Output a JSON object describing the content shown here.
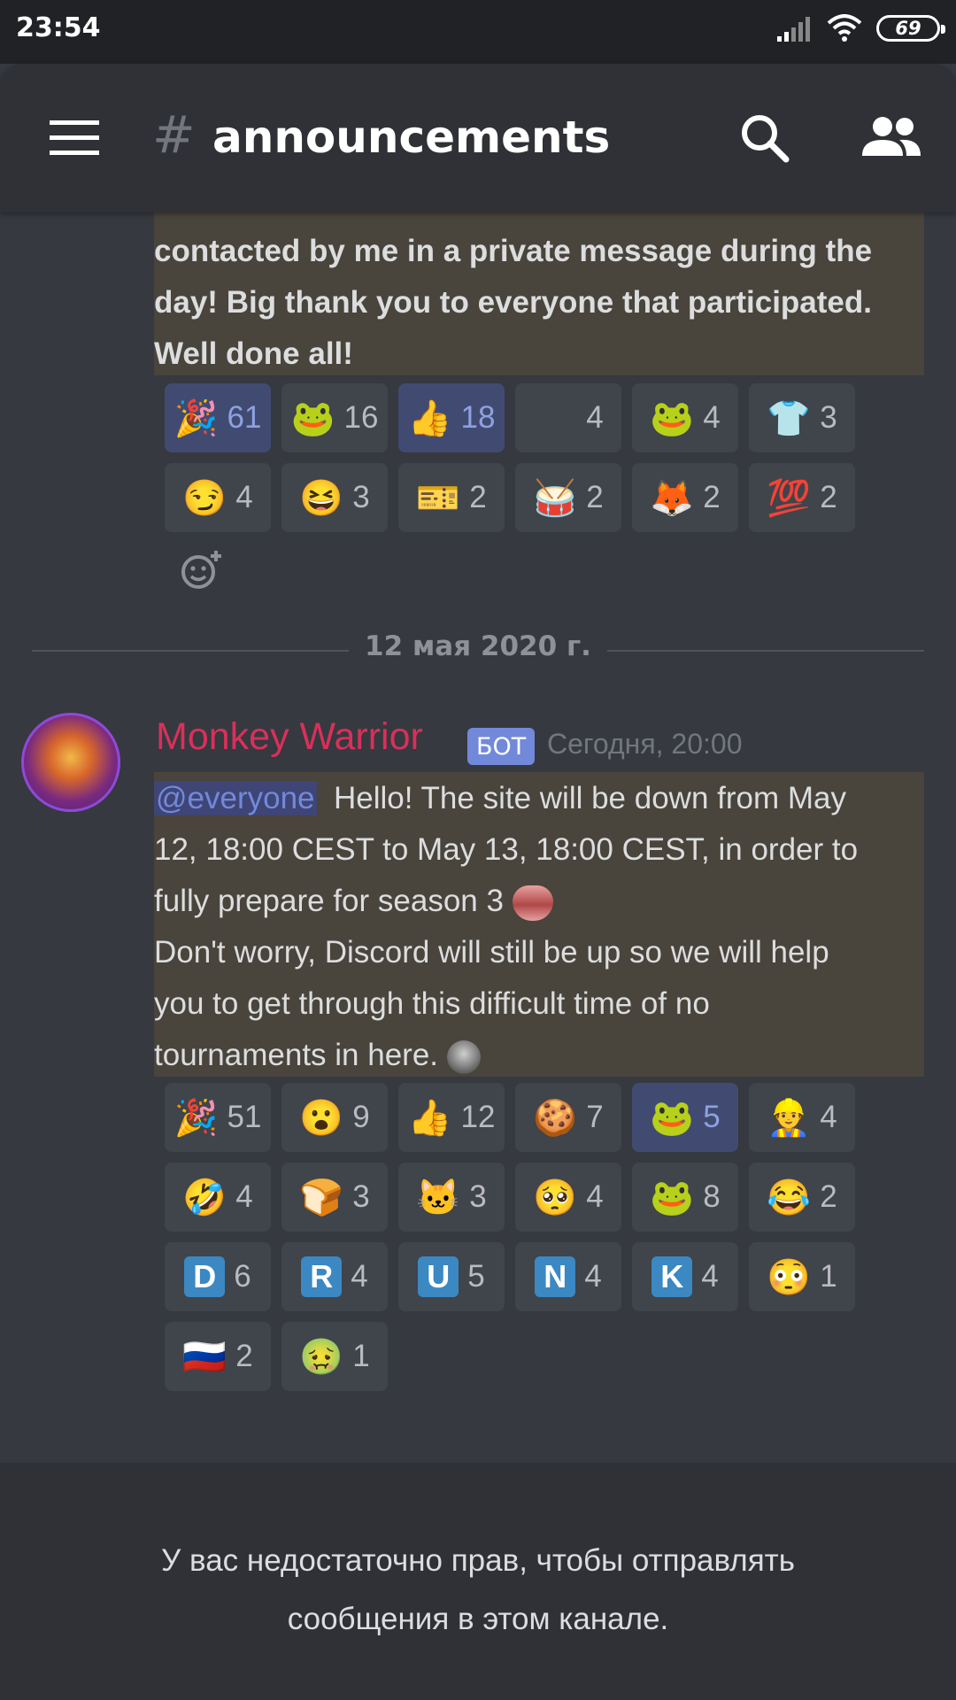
{
  "status_bar": {
    "time": "23:54",
    "battery": "69"
  },
  "header": {
    "hash": "#",
    "channel_name": "announcements"
  },
  "message1": {
    "lines": [
      "contacted by me in a private message during the",
      "day! Big thank you to everyone that participated.",
      "Well done all!"
    ],
    "reactions": [
      {
        "emoji": "party-popper",
        "glyph": "🎉",
        "count": "61",
        "me": true
      },
      {
        "emoji": "pepe-hug",
        "glyph": "🐸",
        "count": "16",
        "me": false
      },
      {
        "emoji": "thumbs-up",
        "glyph": "👍",
        "count": "18",
        "me": true
      },
      {
        "emoji": "blank",
        "glyph": "",
        "count": "4",
        "me": false
      },
      {
        "emoji": "pepe-yes",
        "glyph": "🐸",
        "count": "4",
        "me": false
      },
      {
        "emoji": "t-shirt",
        "glyph": "👕",
        "count": "3",
        "me": false
      },
      {
        "emoji": "meme-face",
        "glyph": "😏",
        "count": "4",
        "me": false
      },
      {
        "emoji": "awesome-face",
        "glyph": "😆",
        "count": "3",
        "me": false
      },
      {
        "emoji": "ticket",
        "glyph": "🎫",
        "count": "2",
        "me": false
      },
      {
        "emoji": "drum",
        "glyph": "🥁",
        "count": "2",
        "me": false
      },
      {
        "emoji": "fox",
        "glyph": "🦊",
        "count": "2",
        "me": false
      },
      {
        "emoji": "hundred-points",
        "glyph": "💯",
        "count": "2",
        "me": false
      }
    ]
  },
  "date_divider": "12 мая 2020 г.",
  "message2": {
    "author": "Monkey Warrior",
    "bot_tag": "БОТ",
    "timestamp": "Сегодня, 20:00",
    "mention": "@everyone",
    "lines": [
      "Hello! The site will be down from May",
      "12, 18:00 CEST  to May 13, 18:00 CEST, in order to",
      "fully prepare for season 3",
      "Don't worry, Discord will still be up so we will help",
      "you to get through this difficult time of no",
      "tournaments in here."
    ],
    "reactions": [
      {
        "emoji": "party-popper",
        "glyph": "🎉",
        "count": "51",
        "me": false
      },
      {
        "emoji": "shouting-face",
        "glyph": "😮",
        "count": "9",
        "me": false
      },
      {
        "emoji": "thumbs-up",
        "glyph": "👍",
        "count": "12",
        "me": false
      },
      {
        "emoji": "cookie-blob",
        "glyph": "🍪",
        "count": "7",
        "me": false
      },
      {
        "emoji": "pepe",
        "glyph": "🐸",
        "count": "5",
        "me": true
      },
      {
        "emoji": "hardhat-blob",
        "glyph": "👷",
        "count": "4",
        "me": false
      },
      {
        "emoji": "rofl",
        "glyph": "🤣",
        "count": "4",
        "me": false
      },
      {
        "emoji": "bread",
        "glyph": "🍞",
        "count": "3",
        "me": false
      },
      {
        "emoji": "nyan-cat",
        "glyph": "🐱",
        "count": "3",
        "me": false
      },
      {
        "emoji": "pleading-blob",
        "glyph": "🥺",
        "count": "4",
        "me": false
      },
      {
        "emoji": "pepe-hands",
        "glyph": "🐸",
        "count": "8",
        "me": false
      },
      {
        "emoji": "joy",
        "glyph": "😂",
        "count": "2",
        "me": false
      },
      {
        "emoji": "letter-d",
        "letter": "D",
        "count": "6",
        "me": false
      },
      {
        "emoji": "letter-r",
        "letter": "R",
        "count": "4",
        "me": false
      },
      {
        "emoji": "letter-u",
        "letter": "U",
        "count": "5",
        "me": false
      },
      {
        "emoji": "letter-n",
        "letter": "N",
        "count": "4",
        "me": false
      },
      {
        "emoji": "letter-k",
        "letter": "K",
        "count": "4",
        "me": false
      },
      {
        "emoji": "face-photo",
        "glyph": "😳",
        "count": "1",
        "me": false
      },
      {
        "emoji": "russia-flag",
        "glyph": "🇷🇺",
        "count": "2",
        "me": false
      },
      {
        "emoji": "nauseated-face",
        "glyph": "🤢",
        "count": "1",
        "me": false
      }
    ]
  },
  "footer": {
    "notice_line1": "У вас недостаточно прав, чтобы отправлять",
    "notice_line2": "сообщения в этом канале."
  }
}
